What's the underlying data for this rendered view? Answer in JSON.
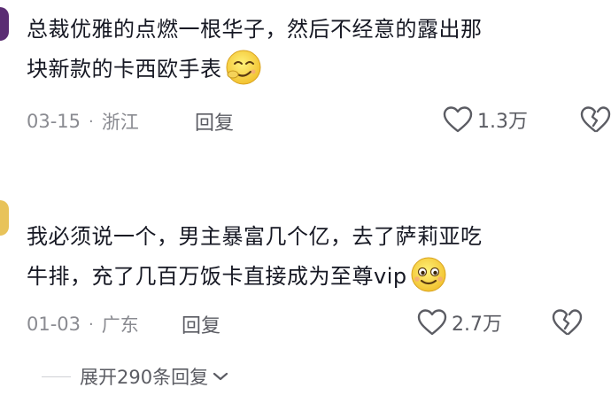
{
  "comments": [
    {
      "text": "总裁优雅的点燃一根华子，然后不经意的露出那块新款的卡西欧手表",
      "line1": "总裁优雅的点燃一根华子，然后不经意的露出那",
      "line2": "块新款的卡西欧手表",
      "emoji": "snickering-face-emoji",
      "date": "03-15",
      "location": "浙江",
      "reply_label": "回复",
      "likes": "1.3万",
      "avatar_color": "#5a2d73"
    },
    {
      "text": "我必须说一个，男主暴富几个亿，去了萨莉亚吃牛排，充了几百万饭卡直接成为至尊vip",
      "line1": "我必须说一个，男主暴富几个亿，去了萨莉亚吃",
      "line2": "牛排，充了几百万饭卡直接成为至尊vip",
      "emoji": "smiling-face-emoji",
      "date": "01-03",
      "location": "广东",
      "reply_label": "回复",
      "likes": "2.7万",
      "avatar_color": "#e8c35a"
    }
  ],
  "separator": "·",
  "expand_replies": "展开290条回复",
  "colors": {
    "text": "#161823",
    "meta": "#8a8b91",
    "action": "#5b5c63"
  }
}
